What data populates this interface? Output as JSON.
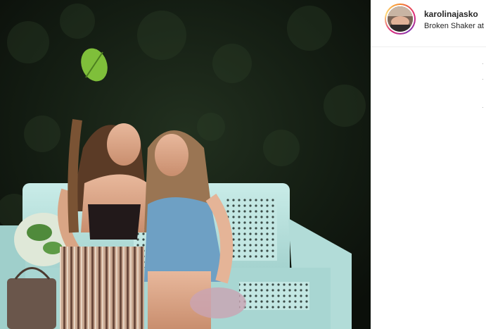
{
  "post": {
    "username": "karolinajasko",
    "location": "Broken Shaker at"
  },
  "colors": {
    "ring_start": "#f58529",
    "ring_end": "#dd2a7b",
    "bench": "#b7e2df",
    "background_foliage": "#1b2a1c"
  },
  "icons": [
    "avatar-image",
    "leaf",
    "bench"
  ]
}
